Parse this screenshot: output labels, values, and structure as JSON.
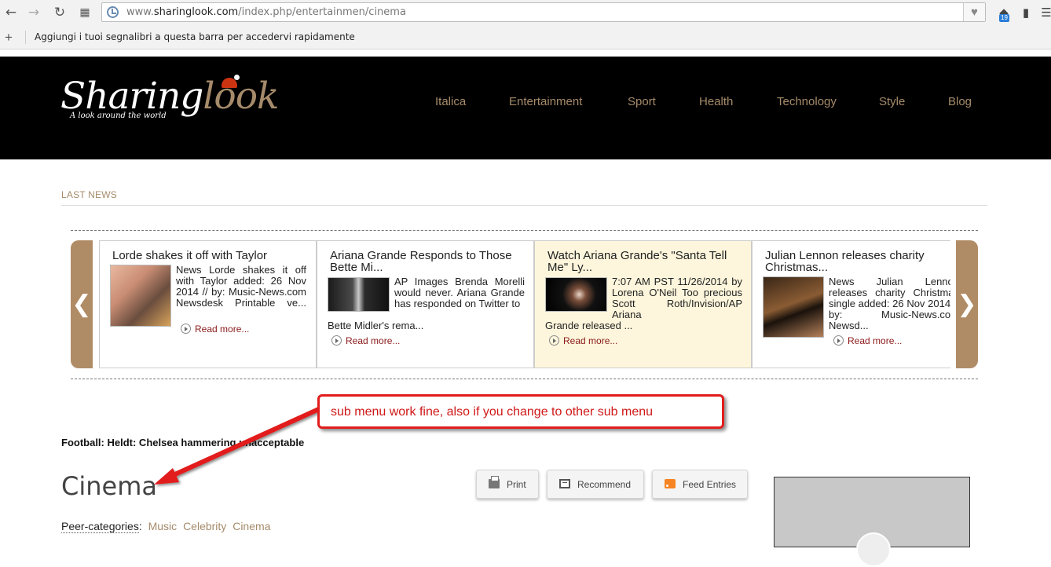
{
  "browser": {
    "url_prefix": "www.",
    "url_domain": "sharinglook.com",
    "url_path": "/index.php/entertainmen/cinema",
    "bookmarks_hint": "Aggiungi i tuoi segnalibri a questa barra per accedervi rapidamente",
    "extension_badge": "19",
    "icons": [
      "back-icon",
      "forward-icon",
      "reload-icon",
      "apps-icon",
      "heart-icon",
      "bookmark-icon",
      "extension-icon"
    ]
  },
  "site": {
    "logo_part1": "Sharing",
    "logo_part2": "look",
    "tagline": "A look around the world",
    "nav": [
      "Italica",
      "Entertainment",
      "Sport",
      "Health",
      "Technology",
      "Style",
      "Blog"
    ]
  },
  "last_news": {
    "label": "LAST NEWS",
    "read_more": "Read more...",
    "items": [
      {
        "title": "Lorde shakes it off with Taylor",
        "text": "News Lorde shakes it off with Taylor added: 26 Nov 2014 // by: Music-News.com Newsdesk Printable ve...",
        "under": ""
      },
      {
        "title": "Ariana Grande Responds to Those Bette Mi...",
        "text": "AP Images Brenda Morelli would never. Ariana Grande has responded on Twitter to",
        "under": "Bette Midler's rema..."
      },
      {
        "title": "Watch Ariana Grande's \"Santa Tell Me\" Ly...",
        "text": "7:07 AM PST 11/26/2014 by Lorena O'Neil Too precious Scott Roth/Invision/AP Ariana",
        "under": "Grande released ..."
      },
      {
        "title": "Julian Lennon releases charity Christmas...",
        "text": "News Julian Lennon releases charity Christmas single added: 26 Nov 2014 // by: Music-News.com Newsd...",
        "under": ""
      }
    ]
  },
  "annotation": {
    "text": "sub menu work fine, also if you change to other sub menu"
  },
  "ticker": "Football: Heldt: Chelsea hammering unacceptable",
  "page_title": "Cinema",
  "buttons": {
    "print": "Print",
    "recommend": "Recommend",
    "feed": "Feed Entries"
  },
  "peer_categories": {
    "label": "Peer-categories",
    "items": [
      "Music",
      "Celebrity",
      "Cinema"
    ]
  }
}
